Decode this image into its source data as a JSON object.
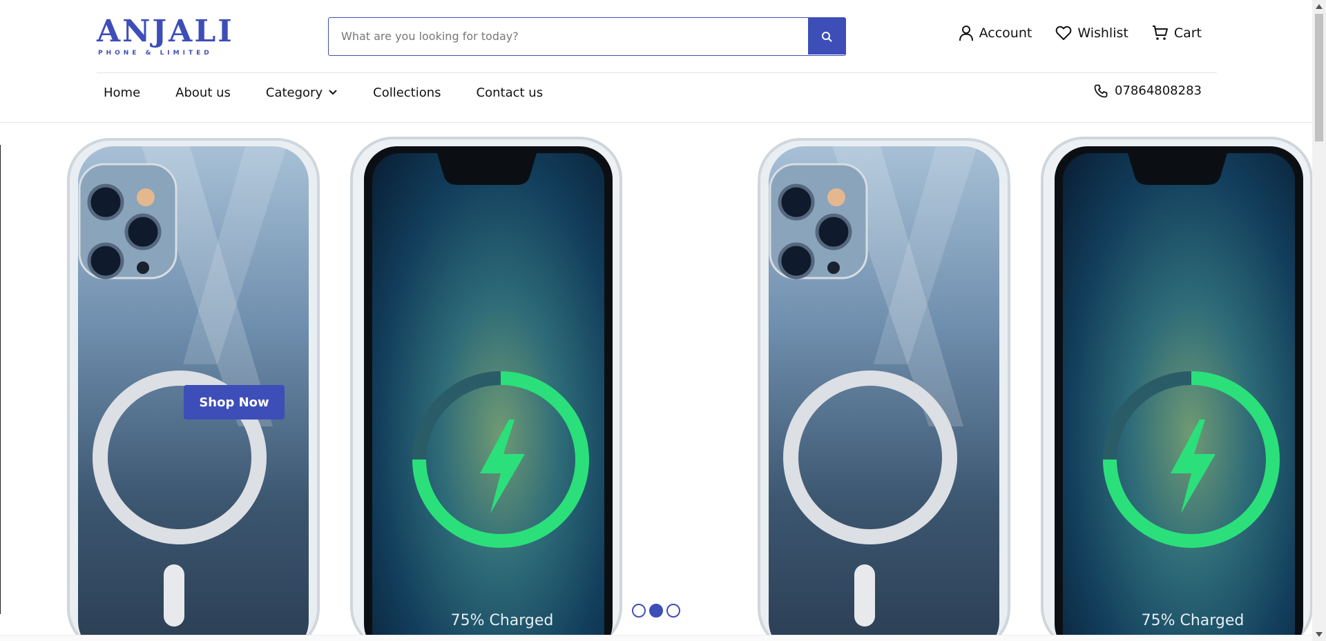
{
  "logo": {
    "name": "ANJALI",
    "tagline": "PHONE & LIMITED"
  },
  "search": {
    "placeholder": "What are you looking for today?",
    "value": ""
  },
  "header_links": {
    "account": "Account",
    "wishlist": "Wishlist",
    "cart": "Cart"
  },
  "nav": {
    "items": [
      "Home",
      "About us",
      "Category",
      "Collections",
      "Contact us"
    ]
  },
  "phone": "07864808283",
  "hero": {
    "button_label": "Shop Now",
    "charge_text": "75% Charged",
    "slide_count": 3,
    "active_slide": 2
  },
  "colors": {
    "brand": "#3d4eb8",
    "charge_green": "#2be07a"
  }
}
